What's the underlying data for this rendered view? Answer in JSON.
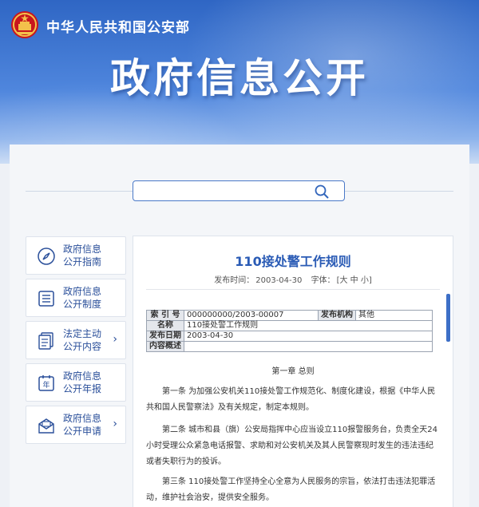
{
  "header": {
    "ministry_name": "中华人民共和国公安部",
    "hero_title": "政府信息公开"
  },
  "search": {
    "placeholder": ""
  },
  "sidebar": {
    "items": [
      {
        "line1": "政府信息",
        "line2": "公开指南",
        "icon": "compass-icon",
        "arrow": ""
      },
      {
        "line1": "政府信息",
        "line2": "公开制度",
        "icon": "document-list-icon",
        "arrow": ""
      },
      {
        "line1": "法定主动",
        "line2": "公开内容",
        "icon": "documents-stack-icon",
        "arrow": "›"
      },
      {
        "line1": "政府信息",
        "line2": "公开年报",
        "icon": "year-calendar-icon",
        "arrow": ""
      },
      {
        "line1": "政府信息",
        "line2": "公开申请",
        "icon": "envelope-icon",
        "arrow": "›"
      }
    ]
  },
  "article": {
    "title": "110接处警工作规则",
    "publish_label": "发布时间：",
    "publish_date": "2003-04-30",
    "font_label": "字体：",
    "font_sizes": "[大 中 小]",
    "info": {
      "index_label": "索 引 号",
      "index_value": "000000000/2003-00007",
      "org_label": "发布机构",
      "org_value": "其他",
      "name_label": "名称",
      "name_value": "110接处警工作规则",
      "date_label": "发布日期",
      "date_value": "2003-04-30",
      "summary_label": "内容概述",
      "summary_value": ""
    },
    "chapter": "第一章 总则",
    "paragraphs": [
      "第一条 为加强公安机关110接处警工作规范化、制度化建设，根据《中华人民共和国人民警察法》及有关规定，制定本规则。",
      "第二条 城市和县（旗）公安局指挥中心应当设立110报警服务台，负责全天24小时受理公众紧急电话报警、求助和对公安机关及其人民警察现时发生的违法违纪或者失职行为的投诉。",
      "第三条 110接处警工作坚持全心全意为人民服务的宗旨，依法打击违法犯罪活动，维护社会治安，提供安全服务。"
    ]
  }
}
